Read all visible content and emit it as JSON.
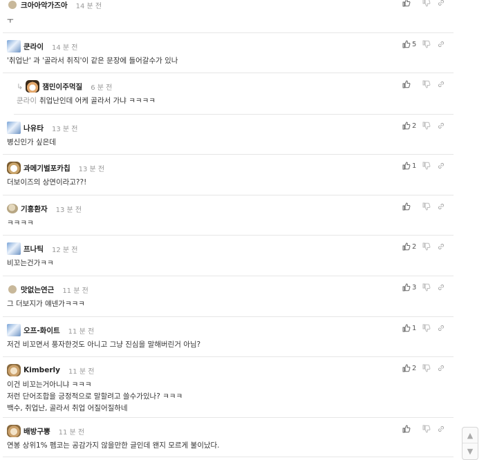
{
  "comments": [
    {
      "avatar": "dot",
      "nick": "크아아악가즈아",
      "time": "14 분 전",
      "body": "ㅜ",
      "likes": "",
      "reply": false,
      "mention": ""
    },
    {
      "avatar": "blue",
      "nick": "쿤라이",
      "time": "14 분 전",
      "body": "'취업난' 과 '골라서 취직'이 같은 문장에 들어갈수가 있나",
      "likes": "5",
      "reply": false,
      "mention": ""
    },
    {
      "avatar": "mouse",
      "nick": "잼민이주먹질",
      "time": "6 분 전",
      "body": "취업난인데 어케 골라서 가냐 ㅋㅋㅋㅋ",
      "likes": "",
      "reply": true,
      "mention": "쿤라이"
    },
    {
      "avatar": "blue",
      "nick": "나유타",
      "time": "13 분 전",
      "body": "병신인가 싶은데",
      "likes": "2",
      "reply": false,
      "mention": ""
    },
    {
      "avatar": "dog",
      "nick": "과메기벌포카칩",
      "time": "13 분 전",
      "body": "더보이즈의 상연이라고??!",
      "likes": "1",
      "reply": false,
      "mention": ""
    },
    {
      "avatar": "stone",
      "nick": "기흥환자",
      "time": "13 분 전",
      "body": "ㅋㅋㅋㅋ",
      "likes": "",
      "reply": false,
      "mention": ""
    },
    {
      "avatar": "blue",
      "nick": "프나틱",
      "time": "12 분 전",
      "body": "비꼬는건가ㅋㅋ",
      "likes": "2",
      "reply": false,
      "mention": ""
    },
    {
      "avatar": "dot",
      "nick": "맛없는연근",
      "time": "11 분 전",
      "body": "그 더보지가 얘넨가ㅋㅋㅋ",
      "likes": "3",
      "reply": false,
      "mention": ""
    },
    {
      "avatar": "blue",
      "nick": "오프-화이트",
      "time": "11 분 전",
      "body": "저건 비꼬면서 풍자한것도 아니고 그냥 진심을 말해버린거 아님?",
      "likes": "1",
      "reply": false,
      "mention": ""
    },
    {
      "avatar": "doge",
      "nick": "Kimberly",
      "time": "11 분 전",
      "body": "이건 비꼬는거아니냐 ㅋㅋㅋ\n저런 단어조합을 긍정적으로 말할려고 쓸수가있나? ㅋㅋㅋ\n백수, 취업난, 골라서 취업 어질어질하네",
      "likes": "2",
      "reply": false,
      "mention": ""
    },
    {
      "avatar": "doge",
      "nick": "배방구뽕",
      "time": "11 분 전",
      "body": "연봉 상위1% 펨코는 공감가지 않을만한 글인데 왠지 모르게 불이났다.",
      "likes": "",
      "reply": false,
      "mention": ""
    }
  ],
  "icons": {
    "like": "thumbs-up-icon",
    "dislike": "thumbs-down-icon",
    "link": "link-icon"
  },
  "scroll": {
    "up": "▲",
    "down": "▼"
  }
}
